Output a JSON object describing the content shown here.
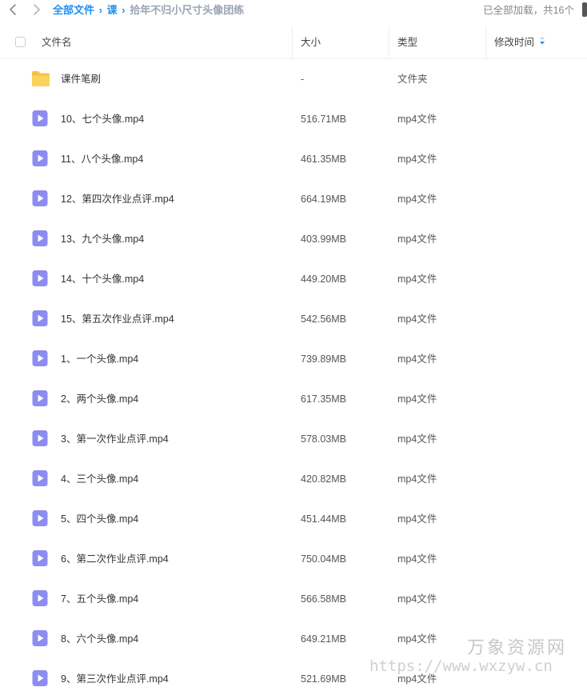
{
  "breadcrumb": {
    "root": "全部文件",
    "separator": "›",
    "parent": "课",
    "current": "拾年不归小尺寸头像团练"
  },
  "status": {
    "loaded_text": "已全部加载，共16个"
  },
  "icons": {
    "back": "chevron-left-icon",
    "forward": "chevron-right-icon",
    "sort": "sort-icon",
    "folder": "folder-icon",
    "video": "video-file-icon"
  },
  "colors": {
    "accent": "#1f8ff0",
    "folder": "#f8c33c",
    "video": "#8c8cf2"
  },
  "columns": {
    "name": "文件名",
    "size": "大小",
    "type": "类型",
    "modified": "修改时间"
  },
  "files": [
    {
      "name": "课件笔刷",
      "size": "-",
      "type": "文件夹",
      "kind": "folder"
    },
    {
      "name": "10、七个头像.mp4",
      "size": "516.71MB",
      "type": "mp4文件",
      "kind": "video"
    },
    {
      "name": "11、八个头像.mp4",
      "size": "461.35MB",
      "type": "mp4文件",
      "kind": "video"
    },
    {
      "name": "12、第四次作业点评.mp4",
      "size": "664.19MB",
      "type": "mp4文件",
      "kind": "video"
    },
    {
      "name": "13、九个头像.mp4",
      "size": "403.99MB",
      "type": "mp4文件",
      "kind": "video"
    },
    {
      "name": "14、十个头像.mp4",
      "size": "449.20MB",
      "type": "mp4文件",
      "kind": "video"
    },
    {
      "name": "15、第五次作业点评.mp4",
      "size": "542.56MB",
      "type": "mp4文件",
      "kind": "video"
    },
    {
      "name": "1、一个头像.mp4",
      "size": "739.89MB",
      "type": "mp4文件",
      "kind": "video"
    },
    {
      "name": "2、两个头像.mp4",
      "size": "617.35MB",
      "type": "mp4文件",
      "kind": "video"
    },
    {
      "name": "3、第一次作业点评.mp4",
      "size": "578.03MB",
      "type": "mp4文件",
      "kind": "video"
    },
    {
      "name": "4、三个头像.mp4",
      "size": "420.82MB",
      "type": "mp4文件",
      "kind": "video"
    },
    {
      "name": "5、四个头像.mp4",
      "size": "451.44MB",
      "type": "mp4文件",
      "kind": "video"
    },
    {
      "name": "6、第二次作业点评.mp4",
      "size": "750.04MB",
      "type": "mp4文件",
      "kind": "video"
    },
    {
      "name": "7、五个头像.mp4",
      "size": "566.58MB",
      "type": "mp4文件",
      "kind": "video"
    },
    {
      "name": "8、六个头像.mp4",
      "size": "649.21MB",
      "type": "mp4文件",
      "kind": "video"
    },
    {
      "name": "9、第三次作业点评.mp4",
      "size": "521.69MB",
      "type": "mp4文件",
      "kind": "video"
    }
  ],
  "watermark": {
    "brand": "万象资源网",
    "url": "https://www.wxzyw.cn"
  }
}
